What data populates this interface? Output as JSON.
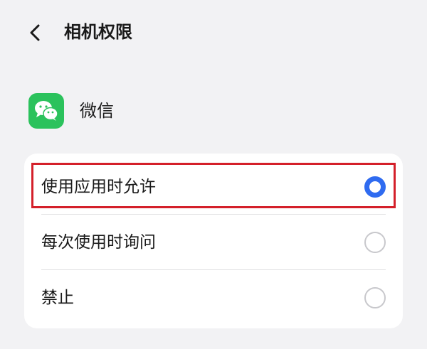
{
  "header": {
    "back_icon": "chevron-left-icon",
    "title": "相机权限"
  },
  "app": {
    "icon": "wechat-icon",
    "icon_color": "#2bc25c",
    "name": "微信"
  },
  "options": [
    {
      "label": "使用应用时允许",
      "selected": true
    },
    {
      "label": "每次使用时询问",
      "selected": false
    },
    {
      "label": "禁止",
      "selected": false
    }
  ],
  "colors": {
    "background": "#f2f2f4",
    "radio_selected": "#2f6bf0",
    "highlight_border": "#d4202a"
  }
}
